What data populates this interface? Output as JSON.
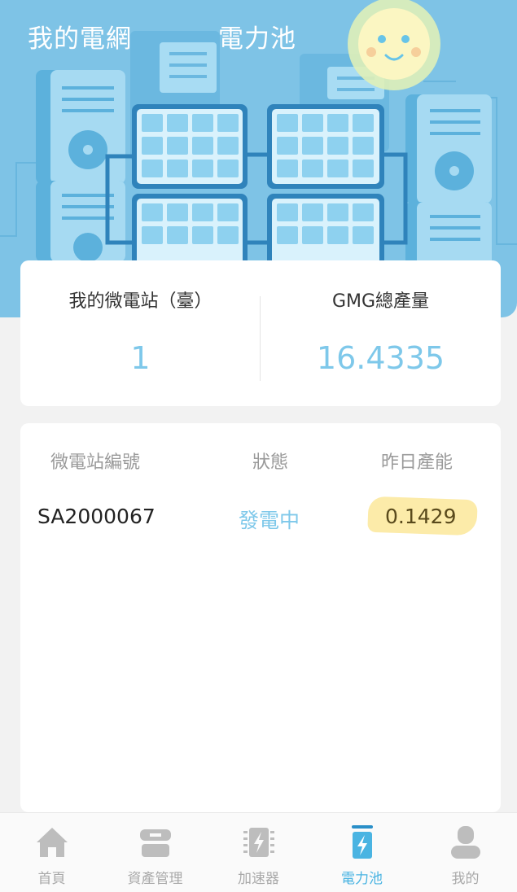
{
  "colors": {
    "hero_background": "#7ec3e6",
    "accent": "#7ec8ea",
    "active_tab": "#4ab4e2",
    "inactive_tab": "#a9a9a9",
    "highlight": "#fbe89a"
  },
  "header": {
    "tabs": [
      {
        "label": "我的電網",
        "active": false
      },
      {
        "label": "電力池",
        "active": true
      }
    ]
  },
  "stats": {
    "stations_label": "我的微電站（臺）",
    "stations_value": "1",
    "gmg_label": "GMG總產量",
    "gmg_value": "16.4335"
  },
  "stations_table": {
    "columns": [
      "微電站編號",
      "狀態",
      "昨日產能"
    ],
    "rows": [
      {
        "id": "SA2000067",
        "status": "發電中",
        "yesterday_output": "0.1429"
      }
    ]
  },
  "bottom_nav": {
    "items": [
      {
        "label": "首頁",
        "icon": "home-icon",
        "active": false
      },
      {
        "label": "資產管理",
        "icon": "asset-box-icon",
        "active": false
      },
      {
        "label": "加速器",
        "icon": "accelerator-chip-icon",
        "active": false
      },
      {
        "label": "電力池",
        "icon": "battery-bolt-icon",
        "active": true
      },
      {
        "label": "我的",
        "icon": "user-icon",
        "active": false
      }
    ]
  }
}
